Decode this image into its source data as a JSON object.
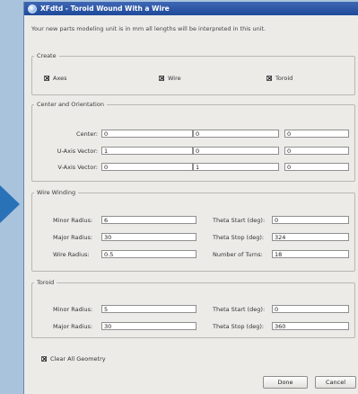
{
  "window": {
    "title": "XFdtd - Toroid Wound With a Wire"
  },
  "info_text": "Your new parts modeling unit is in mm all lengths will be interpreted in this unit.",
  "create": {
    "title": "Create",
    "axes": {
      "label": "Axes",
      "checked": true
    },
    "wire": {
      "label": "Wire",
      "checked": true
    },
    "toroid": {
      "label": "Toroid",
      "checked": true
    }
  },
  "orientation": {
    "title": "Center and Orientation",
    "center": {
      "label": "Center:",
      "x": "0",
      "y": "0",
      "z": "0"
    },
    "u_axis": {
      "label": "U-Axis Vector:",
      "x": "1",
      "y": "0",
      "z": "0"
    },
    "v_axis": {
      "label": "V-Axis Vector:",
      "x": "0",
      "y": "1",
      "z": "0"
    }
  },
  "wire_winding": {
    "title": "Wire Winding",
    "minor_radius": {
      "label": "Minor Radius:",
      "value": "6"
    },
    "major_radius": {
      "label": "Major Radius:",
      "value": "30"
    },
    "wire_radius": {
      "label": "Wire Radius:",
      "value": "0.5"
    },
    "theta_start": {
      "label": "Theta Start (deg):",
      "value": "0"
    },
    "theta_stop": {
      "label": "Theta Stop (deg):",
      "value": "324"
    },
    "turns": {
      "label": "Number of Turns:",
      "value": "18"
    }
  },
  "toroid": {
    "title": "Toroid",
    "minor_radius": {
      "label": "Minor Radius:",
      "value": "5"
    },
    "major_radius": {
      "label": "Major Radius:",
      "value": "30"
    },
    "theta_start": {
      "label": "Theta Start (deg):",
      "value": "0"
    },
    "theta_stop": {
      "label": "Theta Stop (deg):",
      "value": "360"
    }
  },
  "clear_geometry": {
    "label": "Clear All Geometry",
    "checked": true
  },
  "buttons": {
    "done": "Done",
    "cancel": "Cancel"
  },
  "colors": {
    "titlebar": "#2a56a6",
    "backdrop": "#a9c3dd",
    "arrow": "#2a72b8",
    "dialog_bg": "#ecebe8"
  }
}
